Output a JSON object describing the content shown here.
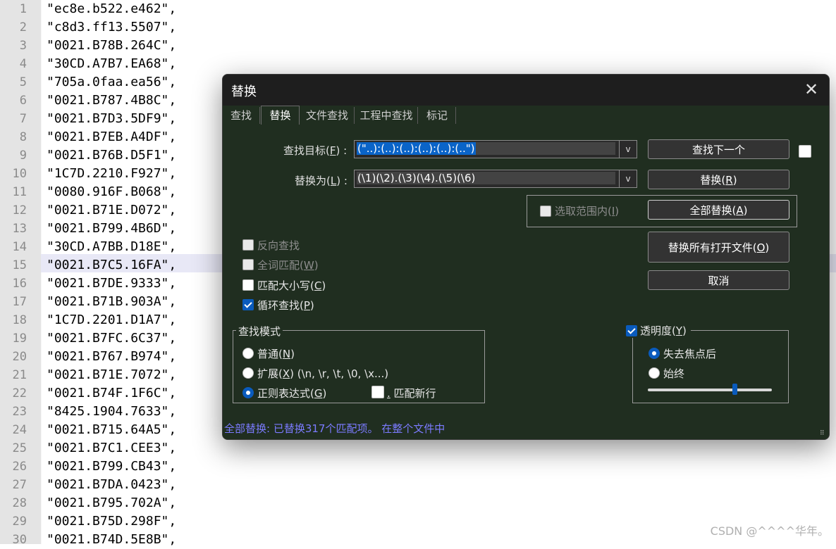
{
  "editor": {
    "lines": [
      {
        "num": "1",
        "text": "\"ec8e.b522.e462\","
      },
      {
        "num": "2",
        "text": "\"c8d3.ff13.5507\","
      },
      {
        "num": "3",
        "text": "\"0021.B78B.264C\","
      },
      {
        "num": "4",
        "text": "\"30CD.A7B7.EA68\","
      },
      {
        "num": "5",
        "text": "\"705a.0faa.ea56\","
      },
      {
        "num": "6",
        "text": "\"0021.B787.4B8C\","
      },
      {
        "num": "7",
        "text": "\"0021.B7D3.5DF9\","
      },
      {
        "num": "8",
        "text": "\"0021.B7EB.A4DF\","
      },
      {
        "num": "9",
        "text": "\"0021.B76B.D5F1\","
      },
      {
        "num": "10",
        "text": "\"1C7D.2210.F927\","
      },
      {
        "num": "11",
        "text": "\"0080.916F.B068\","
      },
      {
        "num": "12",
        "text": "\"0021.B71E.D072\","
      },
      {
        "num": "13",
        "text": "\"0021.B799.4B6D\","
      },
      {
        "num": "14",
        "text": "\"30CD.A7BB.D18E\","
      },
      {
        "num": "15",
        "text": "\"0021.B7C5.16FA\","
      },
      {
        "num": "16",
        "text": "\"0021.B7DE.9333\","
      },
      {
        "num": "17",
        "text": "\"0021.B71B.903A\","
      },
      {
        "num": "18",
        "text": "\"1C7D.2201.D1A7\","
      },
      {
        "num": "19",
        "text": "\"0021.B7FC.6C37\","
      },
      {
        "num": "20",
        "text": "\"0021.B767.B974\","
      },
      {
        "num": "21",
        "text": "\"0021.B71E.7072\","
      },
      {
        "num": "22",
        "text": "\"0021.B74F.1F6C\","
      },
      {
        "num": "23",
        "text": "\"8425.1904.7633\","
      },
      {
        "num": "24",
        "text": "\"0021.B715.64A5\","
      },
      {
        "num": "25",
        "text": "\"0021.B7C1.CEE3\","
      },
      {
        "num": "26",
        "text": "\"0021.B799.CB43\","
      },
      {
        "num": "27",
        "text": "\"0021.B7DA.0423\","
      },
      {
        "num": "28",
        "text": "\"0021.B795.702A\","
      },
      {
        "num": "29",
        "text": "\"0021.B75D.298F\","
      },
      {
        "num": "30",
        "text": "\"0021.B74D.5E8B\","
      }
    ],
    "current_line": "15"
  },
  "watermark": "CSDN @^^^^华年。",
  "dialog": {
    "title": "替换",
    "close_glyph": "✕",
    "tabs": [
      "查找",
      "替换",
      "文件查找",
      "工程中查找",
      "标记"
    ],
    "active_tab": "替换",
    "find": {
      "label_pre": "查找目标(",
      "label_key": "F",
      "label_post": ") :",
      "value": "(\"..):(..):(..):(..):(..):(..\")"
    },
    "replace": {
      "label_pre": "替换为(",
      "label_key": "L",
      "label_post": ") :",
      "value": "(\\1)(\\2).(\\3)(\\4).(\\5)(\\6)"
    },
    "dropdown_glyph": "v",
    "buttons": {
      "find_next": "查找下一个",
      "replace_pre": "替换(",
      "replace_key": "R",
      "replace_post": ")",
      "replace_all_pre": "全部替换(",
      "replace_all_key": "A",
      "replace_all_post": ")",
      "replace_all_open_pre": "替换所有打开文件(",
      "replace_all_open_key": "O",
      "replace_all_open_post": ")",
      "cancel": "取消"
    },
    "in_selection": {
      "pre": "选取范围内(",
      "key": "I",
      "post": ")"
    },
    "options": {
      "backward": {
        "text": "反向查找"
      },
      "whole_word": {
        "pre": "全词匹配(",
        "key": "W",
        "post": ")"
      },
      "match_case": {
        "pre": "匹配大小写(",
        "key": "C",
        "post": ")"
      },
      "wrap": {
        "pre": "循环查找(",
        "key": "P",
        "post": ")"
      }
    },
    "search_mode": {
      "title": "查找模式",
      "normal": {
        "pre": "普通(",
        "key": "N",
        "post": ")"
      },
      "extended": {
        "pre": "扩展(",
        "key": "X",
        "post": ") (\\n, \\r, \\t, \\0, \\x...)"
      },
      "regex": {
        "pre": "正则表达式(",
        "key": "G",
        "post": ")"
      },
      "dot_newline": {
        "key": ".",
        "post": " 匹配新行"
      }
    },
    "transparency": {
      "title_pre": "透明度(",
      "title_key": "Y",
      "title_post": ")",
      "on_lose_focus": "失去焦点后",
      "always": "始终",
      "level": 0.7
    },
    "status": "全部替换: 已替换317个匹配项。 在整个文件中"
  }
}
